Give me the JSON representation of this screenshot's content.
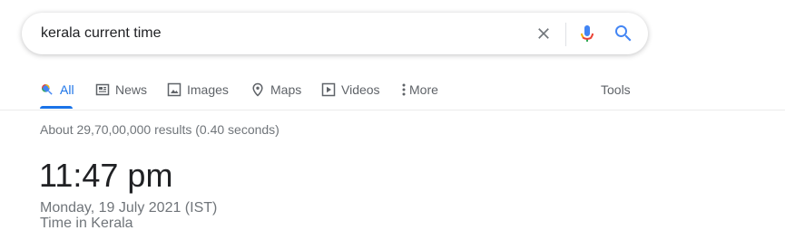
{
  "search": {
    "query": "kerala current time",
    "clear_icon": "close-icon",
    "mic_icon": "microphone-icon",
    "search_icon": "search-icon"
  },
  "tabs": [
    {
      "label": "All",
      "icon": "search-icon",
      "active": true
    },
    {
      "label": "News",
      "icon": "newspaper-icon",
      "active": false
    },
    {
      "label": "Images",
      "icon": "image-icon",
      "active": false
    },
    {
      "label": "Maps",
      "icon": "map-pin-icon",
      "active": false
    },
    {
      "label": "Videos",
      "icon": "play-icon",
      "active": false
    },
    {
      "label": "More",
      "icon": "more-vert-icon",
      "active": false
    }
  ],
  "tools_label": "Tools",
  "result_stats": "About 29,70,00,000 results (0.40 seconds)",
  "time_card": {
    "time": "11:47 pm",
    "date": "Monday, 19 July 2021 (IST)",
    "place": "Time in Kerala"
  },
  "colors": {
    "accent_blue": "#1a73e8",
    "text_primary": "#202124",
    "text_secondary": "#70757a",
    "tab_text": "#5f6368"
  }
}
